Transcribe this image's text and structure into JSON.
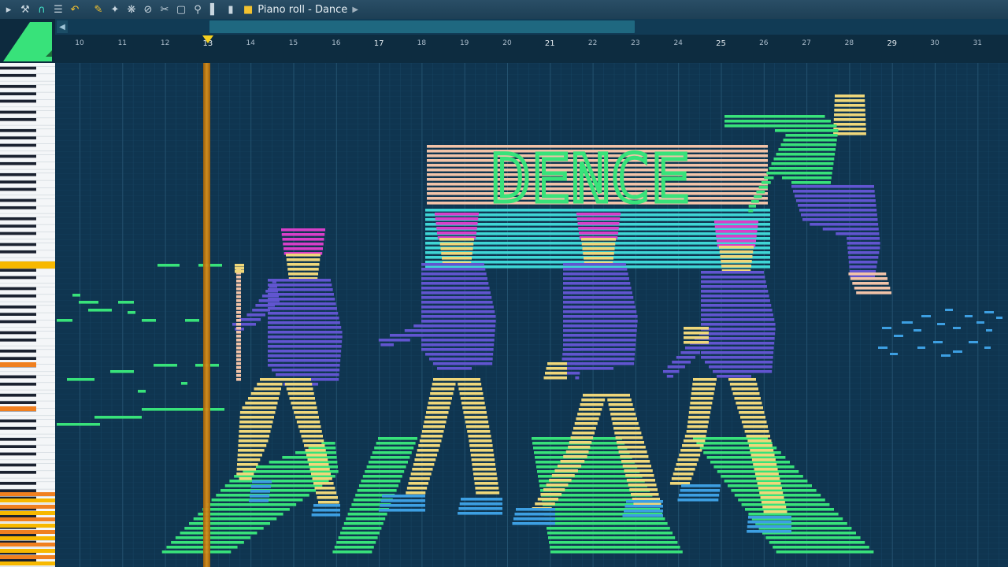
{
  "window": {
    "title": "Piano roll - Dance"
  },
  "toolbar": {
    "icons": [
      "play-arrow-icon",
      "wrench-icon",
      "magnet-icon",
      "menu-icon",
      "undo-icon",
      "pencil-icon",
      "brush-icon",
      "delete-icon",
      "mute-icon",
      "slice-icon",
      "select-icon",
      "zoom-icon",
      "playback-icon"
    ]
  },
  "ruler": {
    "bars": [
      "10",
      "11",
      "12",
      "13",
      "14",
      "15",
      "16",
      "17",
      "18",
      "19",
      "20",
      "21",
      "22",
      "23",
      "24",
      "25",
      "26",
      "27",
      "28",
      "29",
      "30",
      "31"
    ],
    "first_bar": 10,
    "highlighted": [
      "13",
      "17",
      "21",
      "25",
      "29"
    ]
  },
  "banner_text": "DENCE",
  "playhead_bar": 13.0,
  "colors": {
    "background": "#0f3550",
    "accent_green": "#38e27a",
    "playhead": "#d9911c",
    "purple": "#6155d0",
    "yellow": "#efd77a",
    "pink": "#d83fc9",
    "cyan": "#3fd6d6",
    "peach": "#f2c3a8",
    "blue": "#3d9fe2"
  }
}
